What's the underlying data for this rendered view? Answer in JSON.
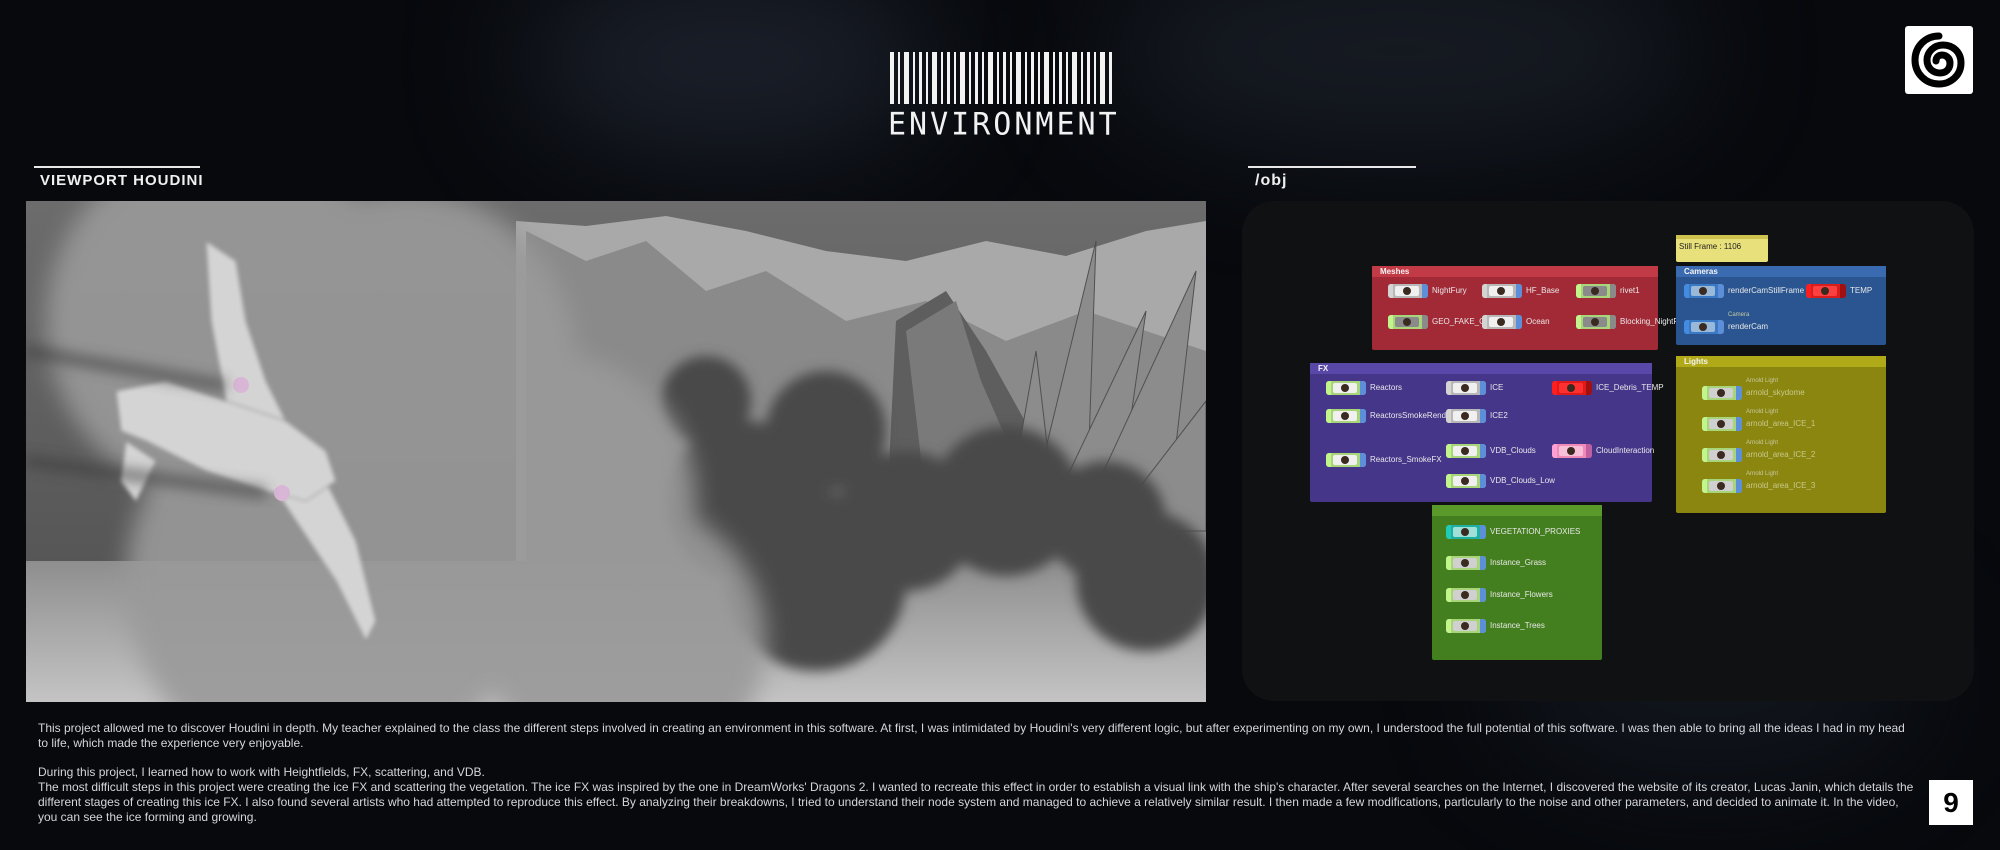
{
  "header": {
    "title": "ENVIRONMENT"
  },
  "sections": {
    "viewport_title": "VIEWPORT HOUDINI",
    "network_title": "/obj"
  },
  "network": {
    "still_frame": "Still Frame : 1106",
    "groups": {
      "meshes": {
        "label": "Meshes",
        "color": "#b8323f",
        "nodes": [
          "NightFury",
          "HF_Base",
          "rivet1",
          "GEO_FAKE_CLOUDS",
          "Ocean",
          "Blocking_NightFury"
        ]
      },
      "cameras": {
        "label": "Cameras",
        "color": "#2f5f9e",
        "nodes": [
          "renderCamStillFrame",
          "TEMP",
          "renderCam"
        ],
        "sub": [
          "",
          "",
          "Camera"
        ]
      },
      "fx": {
        "label": "FX",
        "color": "#4c3b8f",
        "nodes": [
          "Reactors",
          "ICE",
          "ICE_Debris_TEMP",
          "ReactorsSmokeRender",
          "ICE2",
          "VDB_Clouds",
          "CloudInteraction",
          "Reactors_SmokeFX",
          "VDB_Clouds_Low"
        ]
      },
      "lights": {
        "label": "Lights",
        "color": "#9e9a12",
        "nodes": [
          "arnold_skydome",
          "arnold_area_ICE_1",
          "arnold_area_ICE_2",
          "arnold_area_ICE_3"
        ],
        "sub": [
          "Arnold Light",
          "Arnold Light",
          "Arnold Light",
          "Arnold Light"
        ]
      },
      "vegetation": {
        "label": "",
        "color": "#4a8a22",
        "nodes": [
          "VEGETATION_PROXIES",
          "Instance_Grass",
          "Instance_Flowers",
          "Instance_Trees"
        ]
      }
    }
  },
  "description": {
    "p1": "This project allowed me to discover Houdini in depth. My teacher explained to the class the different steps involved in creating an environment in this software. At first, I was intimidated by Houdini's very different logic, but after experimenting on my own, I understood the full potential of this software. I was then able to bring all the ideas I had in my head to life, which made the experience very enjoyable.",
    "p2": "During this project, I learned how to work with Heightfields, FX, scattering, and VDB.",
    "p3": "The most difficult steps in this project were creating the ice FX and scattering the vegetation. The ice FX was inspired by the one in DreamWorks' Dragons 2. I wanted to recreate this effect in order to establish a visual link with the ship's character. After several searches on the Internet, I discovered the website of its creator, Lucas Janin, which details the different stages of creating this ice FX. I also found several artists who had attempted to reproduce this effect. By analyzing their breakdowns, I tried to understand their node system and managed to achieve a relatively similar result. I then made a few modifications, particularly to the noise and other parameters, and decided to animate it. In the video, you can see the ice forming and growing."
  },
  "page_number": "9"
}
